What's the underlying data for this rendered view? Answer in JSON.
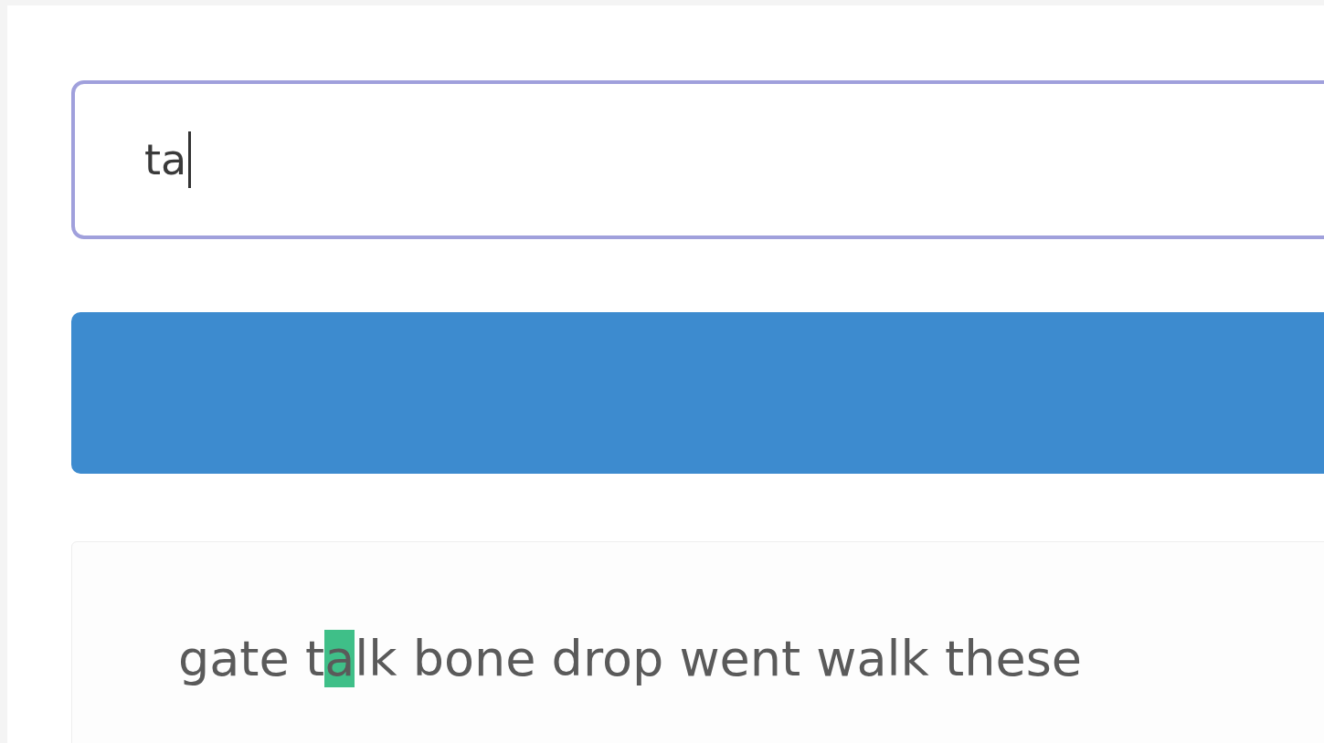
{
  "input": {
    "value": "ta"
  },
  "text_line": {
    "words": [
      {
        "segments": [
          {
            "text": "gate",
            "highlighted": false
          }
        ]
      },
      {
        "segments": [
          {
            "text": "t",
            "highlighted": false
          },
          {
            "text": "a",
            "highlighted": true
          },
          {
            "text": "lk",
            "highlighted": false
          }
        ]
      },
      {
        "segments": [
          {
            "text": "bone",
            "highlighted": false
          }
        ]
      },
      {
        "segments": [
          {
            "text": "drop",
            "highlighted": false
          }
        ]
      },
      {
        "segments": [
          {
            "text": "went",
            "highlighted": false
          }
        ]
      },
      {
        "segments": [
          {
            "text": "walk",
            "highlighted": false
          }
        ]
      },
      {
        "segments": [
          {
            "text": "these",
            "highlighted": false
          }
        ]
      }
    ]
  }
}
